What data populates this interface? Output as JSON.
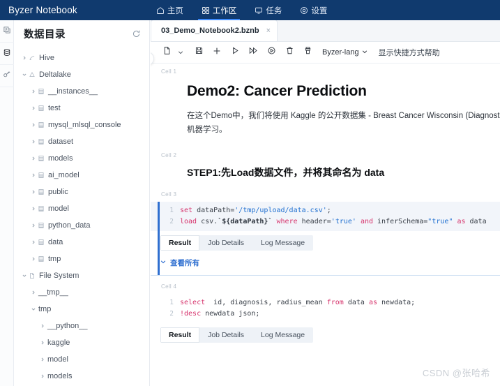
{
  "app": {
    "brand": "Byzer Notebook",
    "accent": "#103A6E",
    "link_color": "#2f6fd0"
  },
  "topnav": {
    "items": [
      {
        "label": "主页",
        "icon": "home-icon",
        "active": false
      },
      {
        "label": "工作区",
        "icon": "workspace-icon",
        "active": true
      },
      {
        "label": "任务",
        "icon": "task-icon",
        "active": false
      },
      {
        "label": "设置",
        "icon": "settings-icon",
        "active": false
      }
    ]
  },
  "rail": {
    "items": [
      {
        "icon": "notebook-icon",
        "active": false
      },
      {
        "icon": "database-icon",
        "active": true
      },
      {
        "icon": "key-icon",
        "active": false
      }
    ]
  },
  "sidebar": {
    "title": "数据目录",
    "refresh_icon": "refresh-icon",
    "collapse_icon": "chevron-left-icon",
    "tree": [
      {
        "label": "Hive",
        "indent": 0,
        "icon": "hive-icon",
        "state": "collapsed"
      },
      {
        "label": "Deltalake",
        "indent": 0,
        "icon": "delta-icon",
        "state": "expanded"
      },
      {
        "label": "__instances__",
        "indent": 1,
        "icon": "table-icon",
        "state": "collapsed"
      },
      {
        "label": "test",
        "indent": 1,
        "icon": "table-icon",
        "state": "collapsed"
      },
      {
        "label": "mysql_mlsql_console",
        "indent": 1,
        "icon": "table-icon",
        "state": "collapsed"
      },
      {
        "label": "dataset",
        "indent": 1,
        "icon": "table-icon",
        "state": "collapsed"
      },
      {
        "label": "models",
        "indent": 1,
        "icon": "table-icon",
        "state": "collapsed"
      },
      {
        "label": "ai_model",
        "indent": 1,
        "icon": "table-icon",
        "state": "collapsed"
      },
      {
        "label": "public",
        "indent": 1,
        "icon": "table-icon",
        "state": "collapsed"
      },
      {
        "label": "model",
        "indent": 1,
        "icon": "table-icon",
        "state": "collapsed"
      },
      {
        "label": "python_data",
        "indent": 1,
        "icon": "table-icon",
        "state": "collapsed"
      },
      {
        "label": "data",
        "indent": 1,
        "icon": "table-icon",
        "state": "collapsed"
      },
      {
        "label": "tmp",
        "indent": 1,
        "icon": "table-icon",
        "state": "collapsed"
      },
      {
        "label": "File System",
        "indent": 0,
        "icon": "file-icon",
        "state": "expanded"
      },
      {
        "label": "__tmp__",
        "indent": 1,
        "icon": "none",
        "state": "collapsed"
      },
      {
        "label": "tmp",
        "indent": 1,
        "icon": "none",
        "state": "expanded"
      },
      {
        "label": "__python__",
        "indent": 2,
        "icon": "none",
        "state": "collapsed"
      },
      {
        "label": "kaggle",
        "indent": 2,
        "icon": "none",
        "state": "collapsed"
      },
      {
        "label": "model",
        "indent": 2,
        "icon": "none",
        "state": "collapsed"
      },
      {
        "label": "models",
        "indent": 2,
        "icon": "none",
        "state": "collapsed"
      }
    ]
  },
  "editor_tabs": [
    {
      "label": "03_Demo_Notebook2.bznb",
      "active": true,
      "close": "×"
    }
  ],
  "toolbar": {
    "buttons": [
      {
        "icon": "new-file-icon",
        "name": "new-file-button"
      },
      {
        "icon": "save-icon",
        "name": "save-button"
      },
      {
        "icon": "add-cell-icon",
        "name": "add-cell-button"
      },
      {
        "icon": "run-icon",
        "name": "run-cell-button"
      },
      {
        "icon": "run-all-icon",
        "name": "run-all-button"
      },
      {
        "icon": "run-from-icon",
        "name": "run-from-here-button"
      },
      {
        "icon": "trash-icon",
        "name": "delete-cell-button"
      },
      {
        "icon": "clear-icon",
        "name": "clear-output-button"
      }
    ],
    "dropdown_caret": "⌄",
    "language": "Byzer-lang",
    "language_caret": "⌄",
    "help_link": "显示快捷方式帮助"
  },
  "cells": [
    {
      "label": "Cell 1",
      "type": "markdown",
      "heading": "Demo2: Cancer Prediction",
      "paragraph_line1": "在这个Demo中，我们将使用 Kaggle 的公开数据集 - Breast Cancer Wisconsin (Diagnostic",
      "paragraph_line2": "机器学习。"
    },
    {
      "label": "Cell 2",
      "type": "markdown",
      "heading": "STEP1:先Load数据文件，并将其命名为 data"
    },
    {
      "label": "Cell 3",
      "type": "code",
      "active": true,
      "line_numbers": [
        "1",
        "2"
      ],
      "result_tabs": [
        {
          "label": "Result",
          "active": true
        },
        {
          "label": "Job Details",
          "active": false
        },
        {
          "label": "Log Message",
          "active": false
        }
      ],
      "view_all": "查看所有",
      "view_all_caret": "⌄"
    },
    {
      "label": "Cell 4",
      "type": "code",
      "active": false,
      "line_numbers": [
        "1",
        "2"
      ],
      "result_tabs": [
        {
          "label": "Result",
          "active": true
        },
        {
          "label": "Job Details",
          "active": false
        },
        {
          "label": "Log Message",
          "active": false
        }
      ]
    }
  ],
  "watermark": "CSDN @张哈希"
}
